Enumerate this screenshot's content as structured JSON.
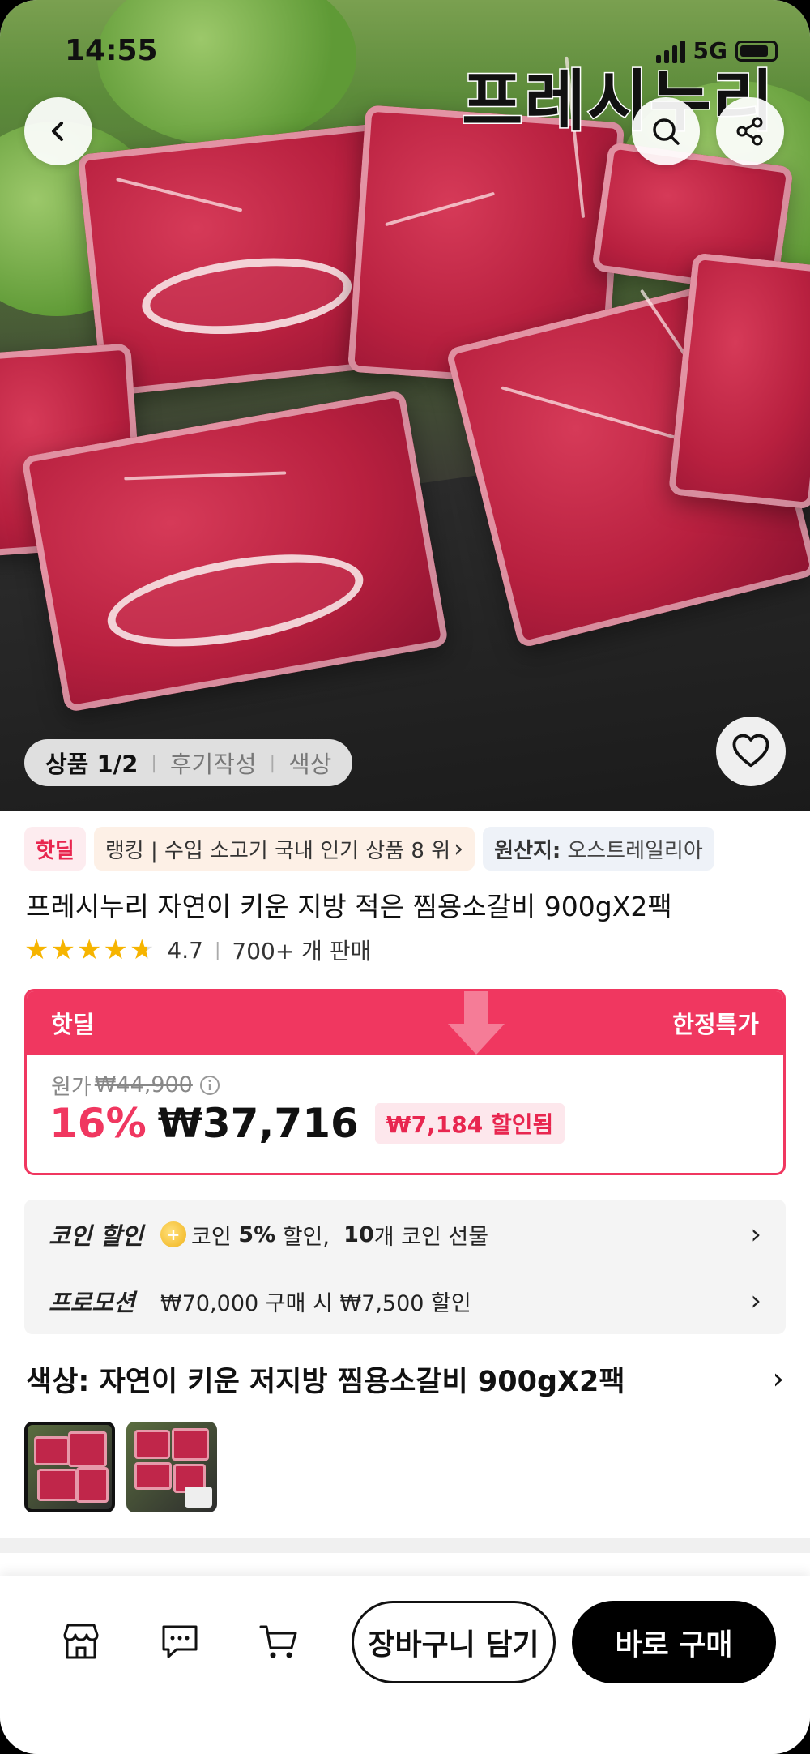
{
  "status_bar": {
    "time": "14:55",
    "network": "5G"
  },
  "hero": {
    "brand_text": "프레시누리",
    "image_tabs": [
      {
        "label": "상품 1/2"
      },
      {
        "label": "후기작성"
      },
      {
        "label": "색상"
      }
    ]
  },
  "chips": {
    "hot_deal": "핫딜",
    "ranking": "랭킹 | 수입 소고기 국내 인기 상품 8 위",
    "origin_label": "원산지:",
    "origin_value": "오스트레일리아"
  },
  "product": {
    "title": "프레시누리 자연이 키운 지방 적은 찜용소갈비 900gX2팩",
    "rating": "4.7",
    "sold": "700+ 개 판매",
    "stars": 4.7
  },
  "deal": {
    "left_label": "핫딜",
    "right_label": "한정특가",
    "orig_label": "원가",
    "orig_price": "₩44,900",
    "discount": "16%",
    "price": "₩37,716",
    "saved": "₩7,184 할인됨"
  },
  "promos": {
    "coin_label": "코인 할인",
    "coin_text_1": "코인",
    "coin_pct": "5%",
    "coin_text_2": "할인,",
    "coin_count": "10",
    "coin_text_3": "개 코인 선물",
    "promo_label": "프로모션",
    "promo_text": "₩70,000 구매 시 ₩7,500 할인"
  },
  "option": {
    "color_text": "색상: 자연이 키운 저지방 찜용소갈비 900gX2팩"
  },
  "bottom_bar": {
    "cart_button": "장바구니 담기",
    "buy_button": "바로 구매"
  },
  "colors": {
    "accent": "#f03760",
    "dark": "#000000"
  }
}
